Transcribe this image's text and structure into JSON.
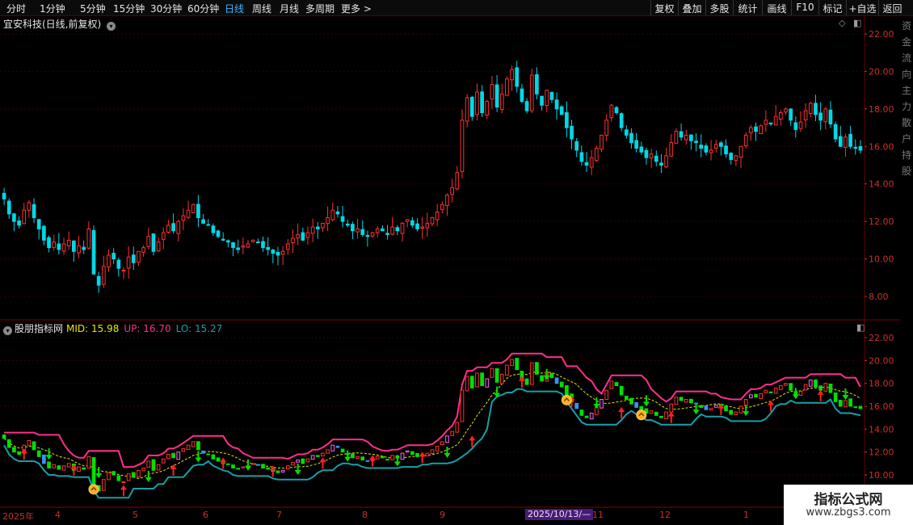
{
  "toolbar": {
    "periods": [
      "分时",
      "1分钟",
      "5分钟",
      "15分钟",
      "30分钟",
      "60分钟",
      "日线",
      "周线",
      "月线",
      "多周期",
      "更多"
    ],
    "active_period": "日线",
    "right_buttons": [
      "复权",
      "叠加",
      "多股",
      "统计",
      "画线",
      "F10",
      "标记",
      "+自选",
      "返回"
    ]
  },
  "stock": {
    "title": "宜安科技(日线,前复权)"
  },
  "indicator": {
    "name": "股朋指标网",
    "mid": "MID: 15.98",
    "up": "UP: 16.70",
    "lo": "LO: 15.27"
  },
  "axes": {
    "main_ticks": [
      "22.00",
      "20.00",
      "18.00",
      "16.00",
      "14.00",
      "12.00",
      "10.00",
      "8.00"
    ],
    "indicator_ticks": [
      "22.00",
      "20.00",
      "18.00",
      "16.00",
      "14.00",
      "12.00",
      "10.00"
    ],
    "months": [
      "2025年",
      "4",
      "5",
      "6",
      "7",
      "8",
      "9",
      "10",
      "11",
      "12",
      "1"
    ],
    "cursor_date": "2025/10/13/—"
  },
  "side_text": [
    "资",
    "金",
    "流",
    "向",
    "主",
    "力",
    "散",
    "户",
    "持",
    "股"
  ],
  "watermark": {
    "title": "指标公式网",
    "url": "www.zbgs3.com"
  },
  "colors": {
    "up_candle": "#ff3030",
    "down_candle": "#00d8e8",
    "up_band": "#ff2f8a",
    "lo_band": "#16a0a8",
    "mid_line": "#e8e800",
    "active_period": "#3fb6ff"
  },
  "chart_data": {
    "type": "candlestick",
    "title": "宜安科技(日线,前复权)",
    "ylim": [
      7.5,
      22.5
    ],
    "x_months": [
      "2025年",
      "4",
      "5",
      "6",
      "7",
      "8",
      "9",
      "10",
      "11",
      "12",
      "1"
    ],
    "close": [
      13.2,
      12.4,
      12.0,
      11.8,
      12.6,
      13.0,
      12.2,
      11.6,
      11.0,
      10.6,
      10.9,
      10.5,
      10.8,
      11.0,
      10.4,
      10.7,
      10.5,
      11.6,
      9.2,
      8.6,
      9.6,
      10.2,
      10.0,
      9.5,
      9.4,
      10.1,
      9.8,
      10.4,
      10.6,
      11.2,
      10.4,
      10.9,
      11.4,
      11.8,
      11.5,
      12.0,
      12.3,
      12.6,
      12.9,
      12.2,
      11.9,
      11.8,
      11.4,
      11.2,
      11.0,
      10.9,
      10.6,
      10.5,
      10.7,
      10.8,
      11.0,
      10.9,
      10.6,
      10.5,
      10.3,
      10.2,
      10.4,
      10.8,
      11.1,
      11.3,
      11.0,
      11.4,
      11.7,
      11.6,
      11.9,
      12.2,
      12.6,
      12.4,
      12.0,
      11.8,
      11.5,
      11.6,
      11.3,
      11.2,
      11.4,
      11.6,
      11.5,
      11.3,
      11.7,
      11.5,
      11.9,
      12.1,
      11.8,
      11.6,
      11.7,
      11.9,
      12.2,
      12.5,
      12.9,
      13.4,
      13.8,
      14.6,
      17.4,
      18.6,
      17.6,
      18.9,
      17.8,
      18.4,
      19.3,
      18.1,
      18.8,
      19.6,
      20.1,
      19.2,
      18.4,
      17.9,
      19.8,
      18.8,
      18.2,
      19.0,
      18.5,
      18.0,
      17.7,
      17.0,
      16.4,
      15.8,
      15.2,
      15.0,
      15.4,
      15.9,
      16.6,
      17.4,
      18.2,
      17.8,
      17.0,
      16.6,
      16.2,
      15.9,
      15.7,
      15.4,
      15.6,
      15.2,
      15.0,
      15.5,
      16.2,
      16.8,
      16.5,
      16.6,
      16.3,
      16.2,
      15.9,
      15.7,
      15.8,
      16.1,
      16.0,
      15.6,
      15.3,
      15.5,
      16.0,
      16.6,
      17.0,
      16.8,
      17.1,
      17.4,
      17.2,
      17.6,
      17.8,
      18.0,
      17.4,
      16.9,
      17.3,
      17.9,
      18.3,
      17.7,
      17.4,
      18.0,
      17.2,
      16.4,
      16.0,
      16.5,
      16.0,
      15.9,
      15.8
    ]
  }
}
